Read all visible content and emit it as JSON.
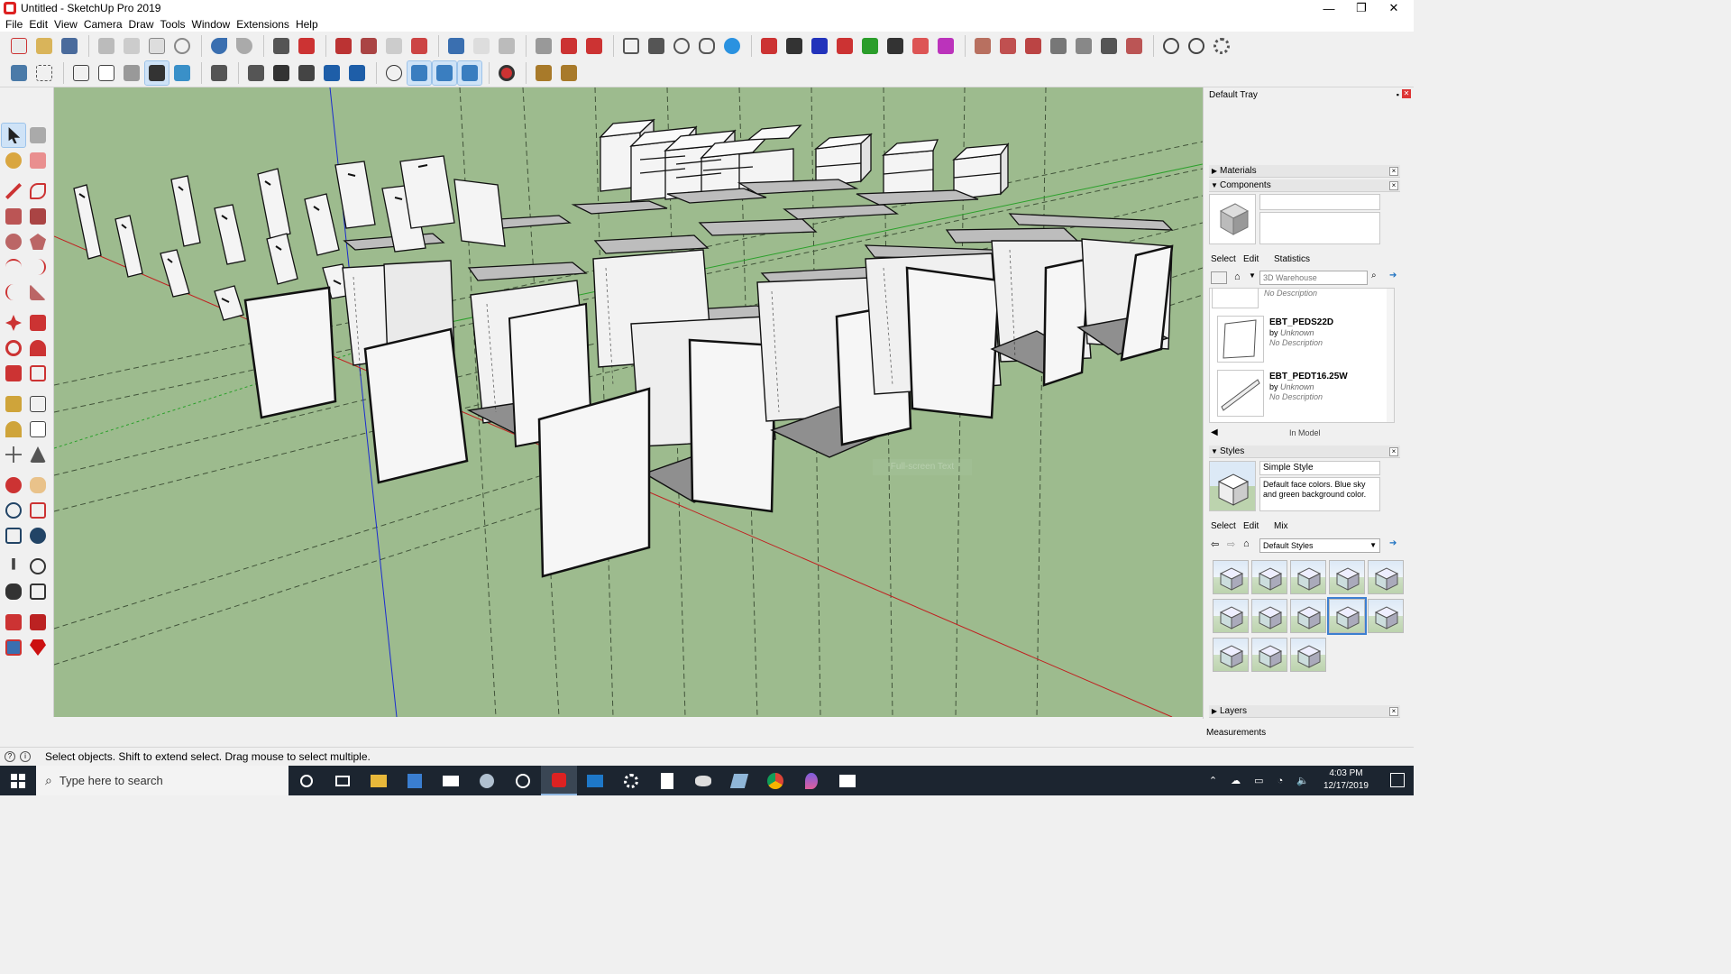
{
  "window": {
    "title": "Untitled - SketchUp Pro 2019",
    "controls": {
      "minimize": "—",
      "maximize": "❐",
      "close": "✕"
    }
  },
  "menu": [
    "File",
    "Edit",
    "View",
    "Camera",
    "Draw",
    "Tools",
    "Window",
    "Extensions",
    "Help"
  ],
  "viewport": {
    "ghost_label": "Full-screen Text",
    "sky_color": "#9dbb8e"
  },
  "tray": {
    "title": "Default Tray",
    "panels": {
      "materials": "Materials",
      "components": "Components",
      "styles": "Styles",
      "layers": "Layers"
    },
    "components": {
      "tabs": [
        "Select",
        "Edit",
        "Statistics"
      ],
      "search_placeholder": "3D Warehouse",
      "partial_desc": "No Description",
      "items": [
        {
          "name": "EBT_PEDS22D",
          "by_label": "by",
          "author": "Unknown",
          "desc": "No Description"
        },
        {
          "name": "EBT_PEDT16.25W",
          "by_label": "by",
          "author": "Unknown",
          "desc": "No Description"
        }
      ],
      "footer": "In Model"
    },
    "styles": {
      "style_name": "Simple Style",
      "style_desc": "Default face colors. Blue sky and green background color.",
      "tabs": [
        "Select",
        "Edit",
        "Mix"
      ],
      "collection": "Default Styles",
      "thumb_count": 13,
      "selected_index": 8
    }
  },
  "measurements_label": "Measurements",
  "status": {
    "message": "Select objects. Shift to extend select. Drag mouse to select multiple."
  },
  "taskbar": {
    "search_placeholder": "Type here to search",
    "time": "4:03 PM",
    "date": "12/17/2019"
  }
}
